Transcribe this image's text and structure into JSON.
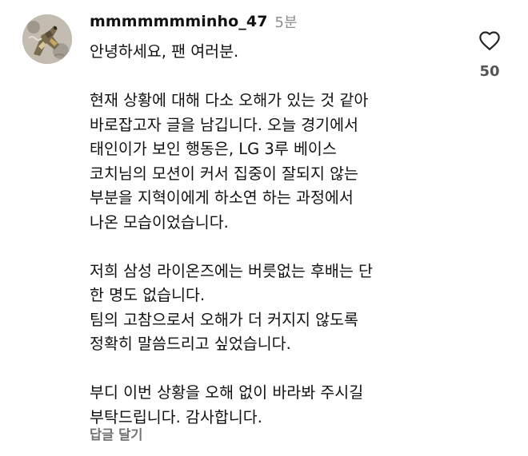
{
  "comment": {
    "username": "mmmmmmminho_47",
    "time": "5분",
    "paragraphs": [
      [
        "안녕하세요, 팬 여러분."
      ],
      [
        "현재 상황에 대해 다소 오해가 있는 것 같아",
        "바로잡고자 글을 남깁니다. 오늘 경기에서",
        "태인이가 보인 행동은, LG 3루 베이스",
        "코치님의 모션이 커서 집중이 잘되지 않는",
        "부분을 지혁이에게 하소연 하는 과정에서",
        "나온 모습이었습니다."
      ],
      [
        "저희 삼성 라이온즈에는 버릇없는 후배는 단",
        "한 명도 없습니다.",
        "팀의 고참으로서 오해가 더 커지지 않도록",
        "정확히 말씀드리고 싶었습니다."
      ],
      [
        "부디 이번 상황을 오해 없이 바라봐 주시길",
        "부탁드립니다. 감사합니다."
      ]
    ],
    "reply_label": "답글 달기",
    "like_count": "50",
    "icons": {
      "avatar": "profile-avatar",
      "like": "heart-outline-icon"
    },
    "colors": {
      "text": "#111111",
      "secondary": "#8e8e8e",
      "reply": "#737373",
      "like_count": "#555555"
    }
  }
}
